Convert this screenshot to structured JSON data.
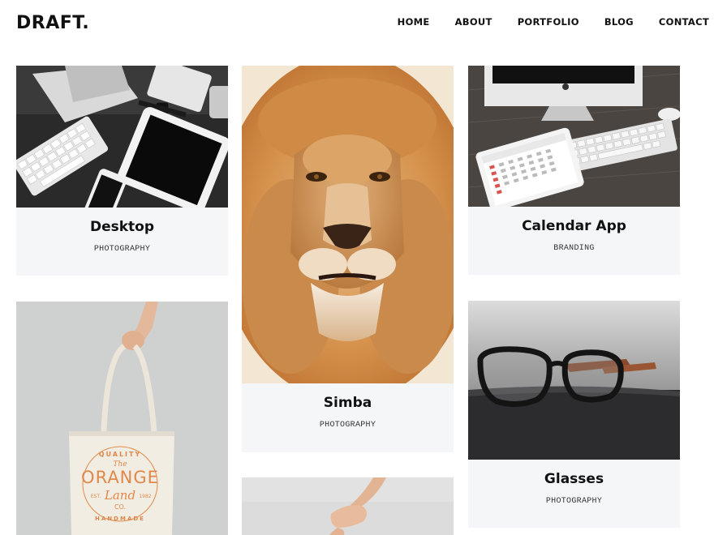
{
  "brand": {
    "logo": "DRAFT."
  },
  "nav": [
    "HOME",
    "ABOUT",
    "PORTFOLIO",
    "BLOG",
    "CONTACT"
  ],
  "cards": [
    {
      "title": "Desktop",
      "category": "PHOTOGRAPHY"
    },
    {
      "title": "Simba",
      "category": "PHOTOGRAPHY"
    },
    {
      "title": "Calendar App",
      "category": "BRANDING"
    },
    {
      "title": "Glasses",
      "category": "PHOTOGRAPHY"
    }
  ],
  "tote": {
    "line1": "QUALITY",
    "line2": "The",
    "line3": "ORANGE",
    "line4a": "EST.",
    "line4b": "Land",
    "line4c": "1982",
    "line5": "CO.",
    "line6": "HANDMADE"
  }
}
